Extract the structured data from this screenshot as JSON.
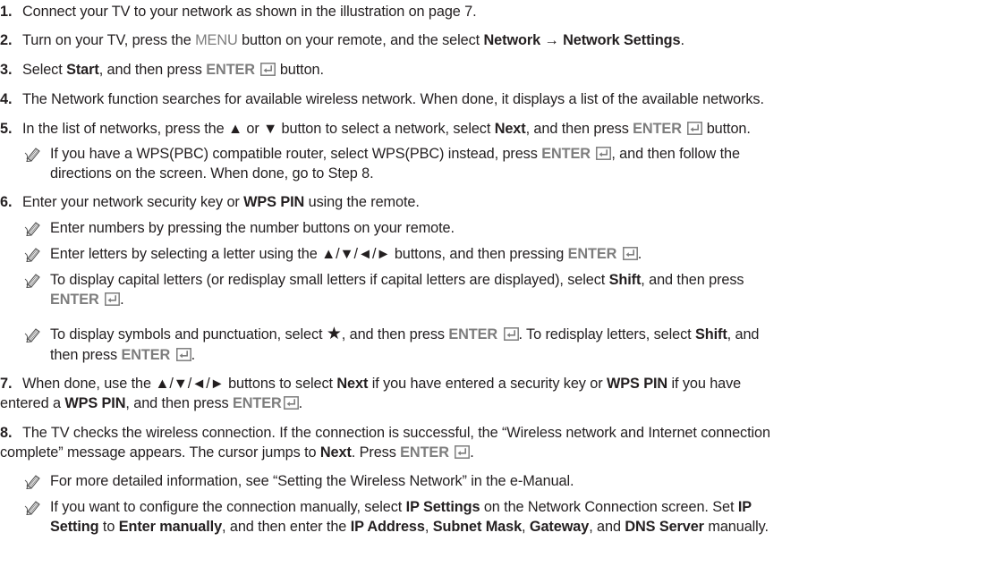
{
  "steps": [
    {
      "num": "1.",
      "line1": "Connect your TV to your network as shown in the illustration on page 7."
    },
    {
      "num": "2.",
      "line1_a": "Turn on your TV, press the ",
      "menu_label": "MENU",
      "line1_b": " button on your remote, and the select ",
      "network_label": "Network",
      "arrow": " → ",
      "network_settings_label": "Network Settings",
      "line1_c": "."
    },
    {
      "num": "3.",
      "line1_a": "Select ",
      "start_label": "Start",
      "line1_b": ", and then press ",
      "enter_label": "ENTER",
      "line1_c": " button."
    },
    {
      "num": "4.",
      "line1": "The Network function searches for available wireless network. When done, it displays a list of the available networks."
    },
    {
      "num": "5.",
      "line1_a": "In the list of networks, press the ▲ or ▼ button to select a network, select ",
      "next_label": "Next",
      "line1_b": ", and then press ",
      "enter_label": "ENTER",
      "line1_c": " button."
    },
    {
      "num": "6.",
      "line1_a": "Enter your network security key or ",
      "wps_pin_label": "WPS PIN",
      "line1_b": " using the remote."
    },
    {
      "num": "7.",
      "line1_a": "When done, use the ▲/▼/◄/► buttons to select ",
      "next_label": "Next",
      "line1_b": " if you have entered a security key or ",
      "wps_pin_label": "WPS PIN",
      "line1_c": " if you have",
      "line2_a": "entered a ",
      "wps_pin_label_2": "WPS PIN",
      "line2_b": ", and then press ",
      "enter_label": "ENTER",
      "line2_c": "."
    },
    {
      "num": "8.",
      "line1": "The TV checks the wireless connection. If the connection is successful, the “Wireless network and Internet connection",
      "line2_a": "complete” message appears. The cursor jumps to ",
      "next_label": "Next",
      "line2_b": ". Press ",
      "enter_label": "ENTER",
      "line2_c": "."
    }
  ],
  "notes": {
    "n5": {
      "line1_a": "If you have a WPS(PBC) compatible router, select WPS(PBC) instead, press ",
      "enter_label": "ENTER",
      "line1_b": ", and then follow the",
      "line2": "directions on the screen. When done, go to Step 8."
    },
    "n6a": {
      "line1": "Enter numbers by pressing the number buttons on your remote."
    },
    "n6b": {
      "line1_a": "Enter letters by selecting a letter using the ▲/▼/◄/► buttons, and then pressing ",
      "enter_label": "ENTER",
      "line1_b": "."
    },
    "n6c": {
      "line1_a": "To display capital letters (or redisplay small letters if capital letters are displayed), select ",
      "shift_label": "Shift",
      "line1_b": ", and then press",
      "enter_label": "ENTER",
      "line2_b": "."
    },
    "n6d": {
      "line1_a": "To display symbols and punctuation, select ",
      "star": "★",
      "line1_b": ", and then press ",
      "enter_label": "ENTER",
      "line1_c": ". To redisplay letters, select ",
      "shift_label": "Shift",
      "line1_d": ", and",
      "line2_a": "then press ",
      "enter_label_2": "ENTER",
      "line2_b": "."
    },
    "n8a": {
      "line1": "For more detailed information, see “Setting the Wireless Network” in the e-Manual."
    },
    "n8b": {
      "line1_a": "If you want to configure the connection manually, select ",
      "ip_settings_label": "IP Settings",
      "line1_b": " on the Network Connection screen. Set ",
      "ip_label": "IP",
      "setting_label": "Setting",
      "to": " to ",
      "enter_manually_label": "Enter manually",
      "line2_a": ", and then enter the ",
      "ip_address_label": "IP Address",
      "comma1": ", ",
      "subnet_mask_label": "Subnet Mask",
      "comma2": ", ",
      "gateway_label": "Gateway",
      "and": ", and ",
      "dns_server_label": "DNS Server",
      "line2_b": " manually."
    }
  }
}
